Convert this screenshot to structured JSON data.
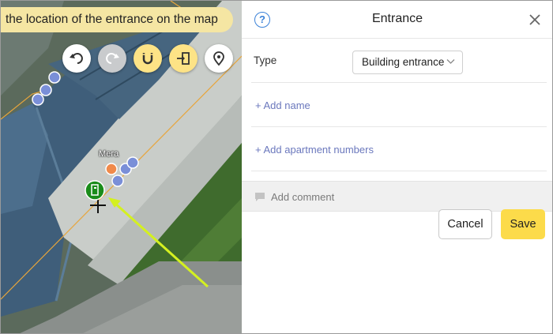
{
  "map": {
    "hint": "the location of the entrance on the map",
    "poi_label": "Мега",
    "toolbar": [
      {
        "name": "undo-button",
        "icon": "undo-icon",
        "style": "white",
        "enabled": true
      },
      {
        "name": "redo-button",
        "icon": "redo-icon",
        "style": "grey",
        "enabled": false
      },
      {
        "name": "magnet-button",
        "icon": "magnet-icon",
        "style": "yellow",
        "enabled": true
      },
      {
        "name": "entrance-button",
        "icon": "entrance-icon",
        "style": "yellow",
        "enabled": true
      },
      {
        "name": "location-pin-button",
        "icon": "location-pin-icon",
        "style": "white",
        "enabled": true
      }
    ]
  },
  "panel": {
    "title": "Entrance",
    "type_label": "Type",
    "type_value": "Building entrance",
    "add_name": "+ Add name",
    "add_apartments": "+ Add apartment numbers",
    "add_comment": "Add comment",
    "cancel_label": "Cancel",
    "save_label": "Save"
  },
  "colors": {
    "save": "#fcdb4a",
    "link": "#6b78bd",
    "hint_bg": "#f5e6a3",
    "help": "#3b82d8",
    "entrance_marker": "#1a8c1a",
    "arrow": "#d4f020"
  }
}
